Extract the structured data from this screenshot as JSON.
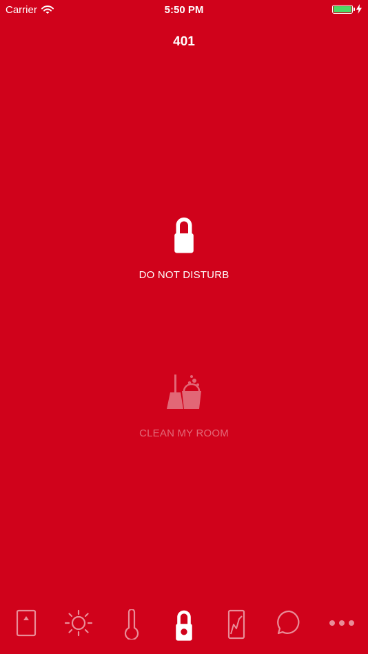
{
  "status_bar": {
    "carrier": "Carrier",
    "time": "5:50 PM",
    "battery_level": 1.0,
    "battery_color": "#4cd964"
  },
  "room": {
    "number": "401"
  },
  "options": {
    "do_not_disturb": {
      "label": "DO NOT DISTURB",
      "icon": "door-hanger-icon",
      "active": true
    },
    "clean_my_room": {
      "label": "CLEAN MY ROOM",
      "icon": "cleaning-bucket-icon",
      "active": false
    }
  },
  "tabs": [
    {
      "icon": "door-key-icon",
      "active": false
    },
    {
      "icon": "sun-icon",
      "active": false
    },
    {
      "icon": "thermometer-icon",
      "active": false
    },
    {
      "icon": "door-hanger-icon",
      "active": true
    },
    {
      "icon": "curtain-icon",
      "active": false
    },
    {
      "icon": "chat-bubble-icon",
      "active": false
    },
    {
      "icon": "more-icon",
      "active": false
    }
  ],
  "colors": {
    "background": "#d0021b",
    "foreground": "#ffffff"
  }
}
